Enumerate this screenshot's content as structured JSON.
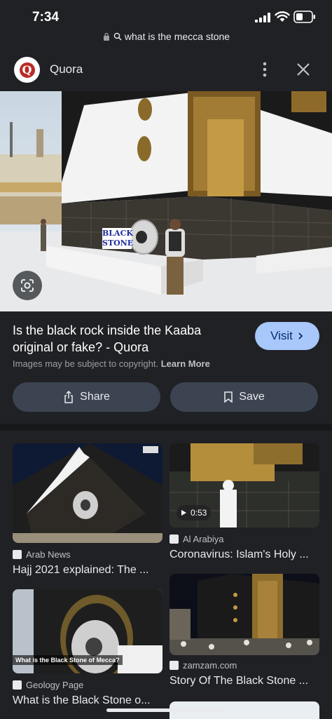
{
  "status_bar": {
    "time": "7:34"
  },
  "url_bar": {
    "text": "what is the mecca stone"
  },
  "source": {
    "name": "Quora",
    "logo_letter": "Q"
  },
  "main_image": {
    "label": "BLACK STONE"
  },
  "result": {
    "title": "Is the black rock inside the Kaaba original or fake? - Quora",
    "visit_label": "Visit",
    "copyright_text": "Images may be subject to copyright.",
    "learn_more": "Learn More",
    "share_label": "Share",
    "save_label": "Save"
  },
  "related": [
    {
      "source": "Arab News",
      "title": "Hajj 2021 explained: The ..."
    },
    {
      "source": "Al Arabiya",
      "title": "Coronavirus: Islam's Holy ...",
      "duration": "0:53"
    },
    {
      "source": "Geology Page",
      "title": "What is the Black Stone o...",
      "caption": "What is the Black Stone of Mecca?"
    },
    {
      "source": "zamzam.com",
      "title": "Story Of The Black Stone ..."
    }
  ],
  "colors": {
    "accent": "#a8c7fa",
    "background": "#202124",
    "button": "#3c4452",
    "quora_red": "#b92b27"
  }
}
